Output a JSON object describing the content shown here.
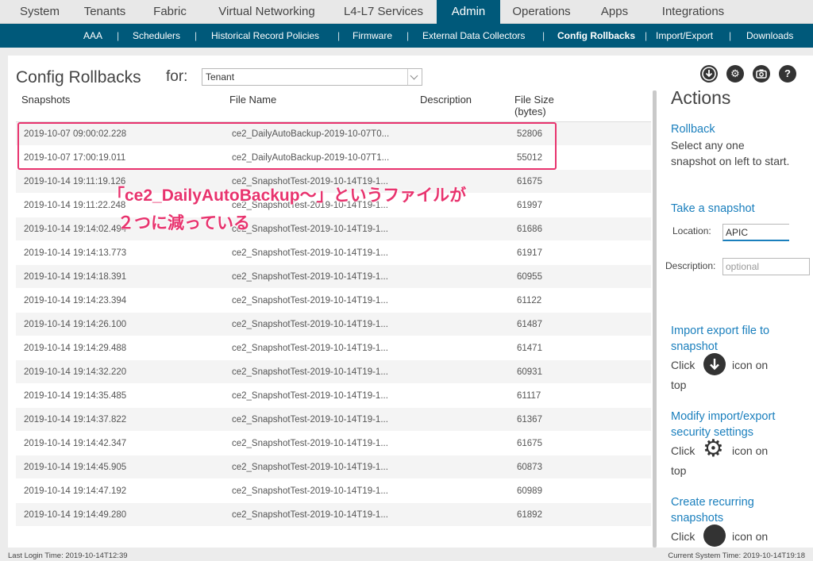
{
  "top_nav": {
    "tabs": [
      "System",
      "Tenants",
      "Fabric",
      "Virtual Networking",
      "L4-L7 Services",
      "Admin",
      "Operations",
      "Apps",
      "Integrations"
    ],
    "active": "Admin"
  },
  "sub_nav": {
    "items": [
      "AAA",
      "Schedulers",
      "Historical Record Policies",
      "Firmware",
      "External Data Collectors",
      "Config Rollbacks",
      "Import/Export",
      "Downloads"
    ],
    "separator": "|",
    "active": "Config Rollbacks"
  },
  "page": {
    "title": "Config Rollbacks",
    "for_label": "for:",
    "tenant_value": "Tenant"
  },
  "toolbar_icons": [
    "download-icon",
    "gear-icon",
    "camera-icon",
    "help-icon"
  ],
  "table": {
    "headers": {
      "snapshots": "Snapshots",
      "file_name": "File Name",
      "description": "Description",
      "file_size": "File Size",
      "file_size_unit": "(bytes)"
    },
    "rows": [
      {
        "snapshot": "2019-10-07 09:00:02.228",
        "file": "ce2_DailyAutoBackup-2019-10-07T0...",
        "size": "52806"
      },
      {
        "snapshot": "2019-10-07 17:00:19.011",
        "file": "ce2_DailyAutoBackup-2019-10-07T1...",
        "size": "55012"
      },
      {
        "snapshot": "2019-10-14 19:11:19.126",
        "file": "ce2_SnapshotTest-2019-10-14T19-1...",
        "size": "61675"
      },
      {
        "snapshot": "2019-10-14 19:11:22.248",
        "file": "ce2_SnapshotTest-2019-10-14T19-1...",
        "size": "61997"
      },
      {
        "snapshot": "2019-10-14 19:14:02.494",
        "file": "ce2_SnapshotTest-2019-10-14T19-1...",
        "size": "61686"
      },
      {
        "snapshot": "2019-10-14 19:14:13.773",
        "file": "ce2_SnapshotTest-2019-10-14T19-1...",
        "size": "61917"
      },
      {
        "snapshot": "2019-10-14 19:14:18.391",
        "file": "ce2_SnapshotTest-2019-10-14T19-1...",
        "size": "60955"
      },
      {
        "snapshot": "2019-10-14 19:14:23.394",
        "file": "ce2_SnapshotTest-2019-10-14T19-1...",
        "size": "61122"
      },
      {
        "snapshot": "2019-10-14 19:14:26.100",
        "file": "ce2_SnapshotTest-2019-10-14T19-1...",
        "size": "61487"
      },
      {
        "snapshot": "2019-10-14 19:14:29.488",
        "file": "ce2_SnapshotTest-2019-10-14T19-1...",
        "size": "61471"
      },
      {
        "snapshot": "2019-10-14 19:14:32.220",
        "file": "ce2_SnapshotTest-2019-10-14T19-1...",
        "size": "60931"
      },
      {
        "snapshot": "2019-10-14 19:14:35.485",
        "file": "ce2_SnapshotTest-2019-10-14T19-1...",
        "size": "61117"
      },
      {
        "snapshot": "2019-10-14 19:14:37.822",
        "file": "ce2_SnapshotTest-2019-10-14T19-1...",
        "size": "61367"
      },
      {
        "snapshot": "2019-10-14 19:14:42.347",
        "file": "ce2_SnapshotTest-2019-10-14T19-1...",
        "size": "61675"
      },
      {
        "snapshot": "2019-10-14 19:14:45.905",
        "file": "ce2_SnapshotTest-2019-10-14T19-1...",
        "size": "60873"
      },
      {
        "snapshot": "2019-10-14 19:14:47.192",
        "file": "ce2_SnapshotTest-2019-10-14T19-1...",
        "size": "60989"
      },
      {
        "snapshot": "2019-10-14 19:14:49.280",
        "file": "ce2_SnapshotTest-2019-10-14T19-1...",
        "size": "61892"
      }
    ]
  },
  "annotation": {
    "line1": "「ce2_DailyAutoBackup～」というファイルが",
    "line2": "２つに減っている"
  },
  "actions": {
    "title": "Actions",
    "rollback_link": "Rollback",
    "rollback_text": "Select any one snapshot on left to start.",
    "take_snapshot_link": "Take a snapshot",
    "location_label": "Location:",
    "location_value": "APIC",
    "description_label": "Description:",
    "description_placeholder": "optional",
    "import_link": "Import export file to snapshot",
    "click_label": "Click",
    "icon_on_label": "icon on",
    "top_label": "top",
    "modify_link": "Modify import/export security settings",
    "recurring_link": "Create recurring snapshots"
  },
  "footer": {
    "last_login": "Last Login Time: 2019-10-14T12:39",
    "current_time": "Current System Time: 2019-10-14T19:18"
  },
  "colors": {
    "nav_blue": "#00597a",
    "link_blue": "#1a7fbd",
    "annotation_pink": "#e8336e"
  }
}
